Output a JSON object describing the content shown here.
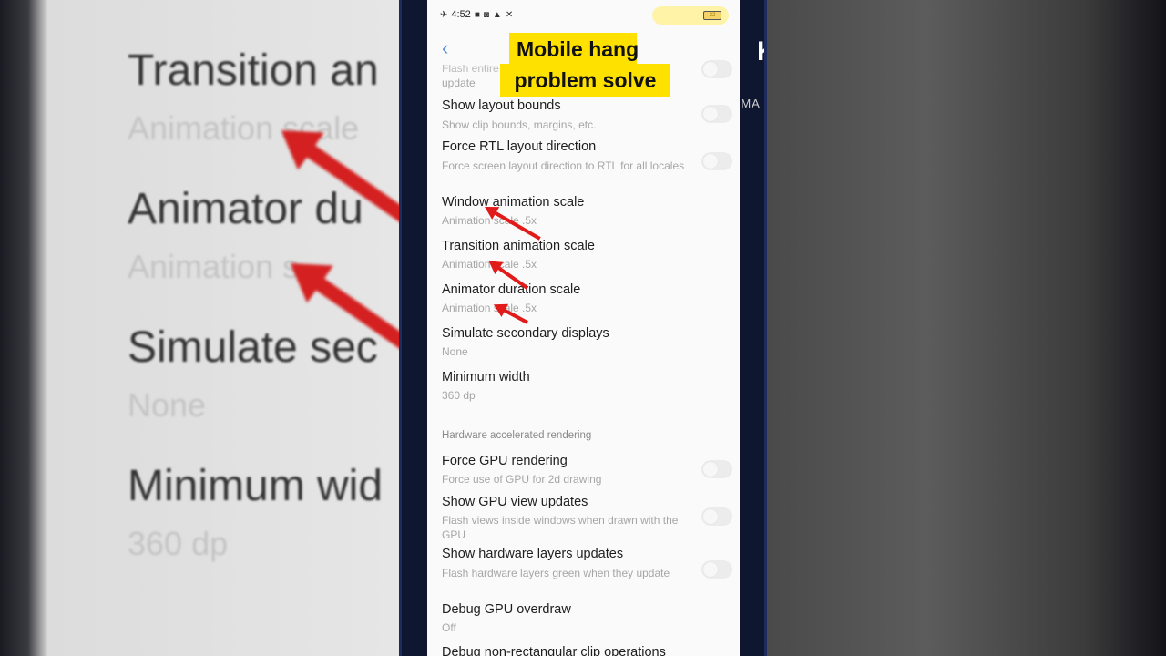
{
  "overlay": {
    "caption_line1": "Mobile hang",
    "caption_line2": "problem solve"
  },
  "status_bar": {
    "time": "4:52",
    "battery_level": "22",
    "icons": [
      "airplane-icon",
      "video-icon",
      "instagram-icon",
      "alert-icon",
      "tools-icon"
    ]
  },
  "header": {
    "back_icon": "chevron-left-icon"
  },
  "settings": {
    "clipped_top": {
      "title": "Flash entire window surfaces when they",
      "subtitle": "update"
    },
    "items": [
      {
        "title": "Show layout bounds",
        "subtitle": "Show clip bounds, margins, etc."
      },
      {
        "title": "Force RTL layout direction",
        "subtitle": "Force screen layout direction to RTL for all locales"
      },
      {
        "title": "Window animation scale",
        "subtitle": "Animation scale .5x"
      },
      {
        "title": "Transition animation scale",
        "subtitle": "Animation scale .5x"
      },
      {
        "title": "Animator duration scale",
        "subtitle": "Animation scale .5x"
      },
      {
        "title": "Simulate secondary displays",
        "subtitle": "None"
      },
      {
        "title": "Minimum width",
        "subtitle": "360 dp"
      }
    ],
    "section_header": "Hardware accelerated rendering",
    "hw_items": [
      {
        "title": "Force GPU rendering",
        "subtitle": "Force use of GPU for 2d drawing"
      },
      {
        "title": "Show GPU view updates",
        "subtitle": "Flash views inside windows when drawn with the GPU"
      },
      {
        "title": "Show hardware layers updates",
        "subtitle": "Flash hardware layers green when they update"
      },
      {
        "title": "Debug GPU overdraw",
        "subtitle": "Off"
      },
      {
        "title": "Debug non-rectangular clip operations",
        "subtitle": ""
      }
    ]
  },
  "background": {
    "items": [
      {
        "title": "Transition an",
        "subtitle": "Animation scale"
      },
      {
        "title": "Animator du",
        "subtitle": "Animation s"
      },
      {
        "title": "Simulate sec",
        "subtitle": "None"
      },
      {
        "title": "Minimum wid",
        "subtitle": "360 dp"
      }
    ]
  },
  "side_logo": {
    "letter": "K",
    "text": "KINEMA"
  },
  "colors": {
    "caption_bg": "#ffe100",
    "arrow": "#e11a1a",
    "back_icon": "#5a8dd8"
  }
}
